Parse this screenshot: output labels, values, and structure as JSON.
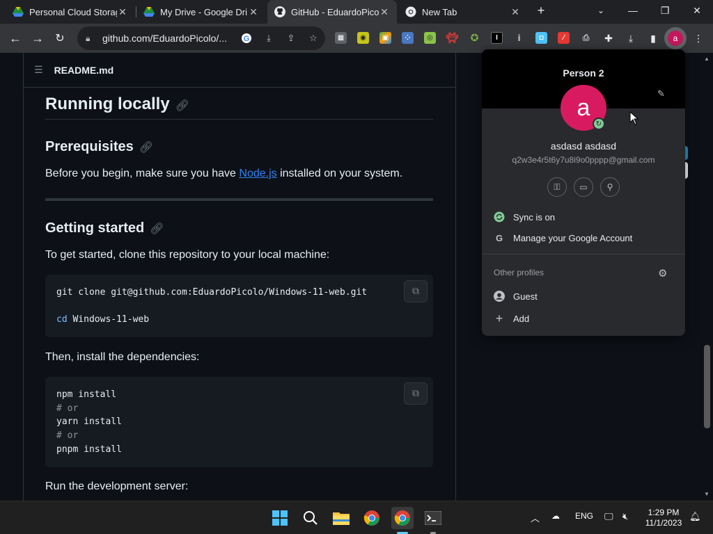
{
  "browser": {
    "tabs": [
      {
        "title": "Personal Cloud Storag",
        "active": false
      },
      {
        "title": "My Drive - Google Dri",
        "active": false
      },
      {
        "title": "GitHub - EduardoPicol",
        "active": true
      },
      {
        "title": "New Tab",
        "active": false
      }
    ],
    "new_tab_label": "+",
    "url": "github.com/EduardoPicolo/..."
  },
  "readme": {
    "filename": "README.md",
    "h_running": "Running locally",
    "h_prereq": "Prerequisites",
    "prereq_before": "Before you begin, make sure you have ",
    "prereq_link": "Node.js",
    "prereq_after": " installed on your system.",
    "h_getting": "Getting started",
    "getting_text": "To get started, clone this repository to your local machine:",
    "code1_line1": "git clone git@github.com:EduardoPicolo/Windows-11-web.git",
    "code1_line2_kw": "cd",
    "code1_line2_rest": " Windows-11-web",
    "deps_text": "Then, install the dependencies:",
    "code2": {
      "l1": "npm install",
      "l2": "# or",
      "l3": "yarn install",
      "l4": "# or",
      "l5": "pnpm install"
    },
    "run_text": "Run the development server:"
  },
  "profile_popup": {
    "profile_name": "Person 2",
    "avatar_letter": "a",
    "user_name": "asdasd asdasd",
    "email": "q2w3e4r5t6y7u8i9o0pppp@gmail.com",
    "sync_label": "Sync is on",
    "manage_label": "Manage your Google Account",
    "other_profiles_label": "Other profiles",
    "guest_label": "Guest",
    "add_label": "Add",
    "avatar_color": "#d81b60"
  },
  "taskbar": {
    "lang": "ENG",
    "time": "1:29 PM",
    "date": "11/1/2023"
  }
}
